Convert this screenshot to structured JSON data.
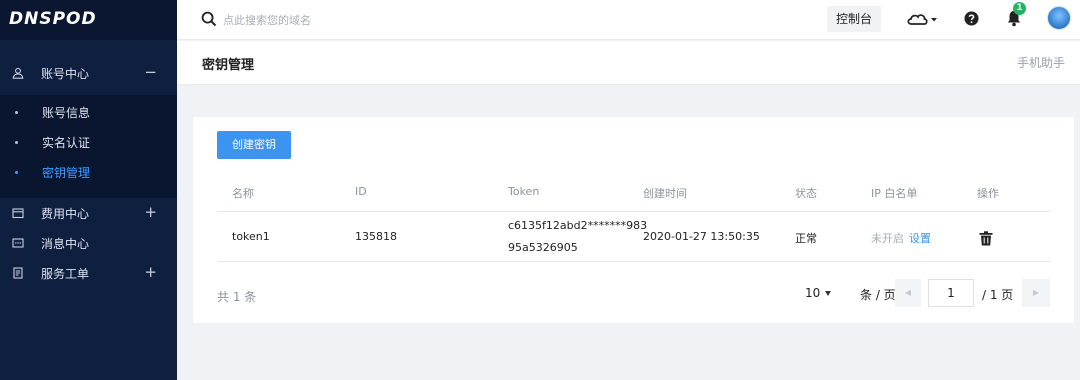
{
  "brand": {
    "logo": "DNSPOD"
  },
  "sidebar": {
    "groups": [
      {
        "label": "账号中心",
        "toggle": "−",
        "icon": "user-icon"
      },
      {
        "label": "费用中心",
        "toggle": "+",
        "icon": "wallet-icon"
      },
      {
        "label": "消息中心",
        "icon": "message-icon"
      },
      {
        "label": "服务工单",
        "toggle": "+",
        "icon": "ticket-icon"
      }
    ],
    "account_items": [
      {
        "label": "账号信息",
        "active": false
      },
      {
        "label": "实名认证",
        "active": false
      },
      {
        "label": "密钥管理",
        "active": true
      }
    ]
  },
  "topbar": {
    "search_placeholder": "点此搜索您的域名",
    "console_label": "控制台",
    "notification_count": "1",
    "icons": [
      "search-icon",
      "cloud-icon",
      "help-icon",
      "bell-icon",
      "avatar"
    ]
  },
  "page": {
    "title": "密钥管理",
    "helper_link": "手机助手"
  },
  "keys": {
    "create_label": "创建密钥",
    "columns": [
      "名称",
      "ID",
      "Token",
      "创建时间",
      "状态",
      "IP 白名单",
      "操作"
    ],
    "rows": [
      {
        "name": "token1",
        "id": "135818",
        "token_line1": "c6135f12abd2*******983",
        "token_line2": "95a5326905",
        "created": "2020-01-27 13:50:35",
        "status": "正常",
        "whitelist_status": "未开启",
        "whitelist_action": "设置"
      }
    ]
  },
  "pagination": {
    "total": "共 1 条",
    "page_size": "10",
    "per_page_label": "条 / 页",
    "current_page": "1",
    "total_pages": "/ 1 页",
    "prev": "◀",
    "next": "▶"
  },
  "colors": {
    "sidebar_bg": "#0f1f3f",
    "accent": "#3b95f0",
    "badge": "#23b25f"
  }
}
